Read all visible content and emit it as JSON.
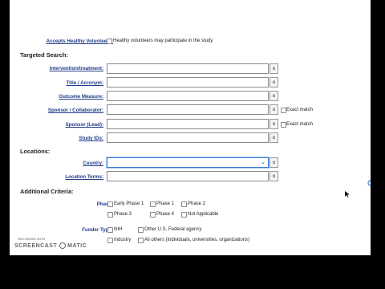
{
  "healthy_volunteers": {
    "label": "Accepts Healthy Volunteers:",
    "option": "Healthy volunteers may participate in the study"
  },
  "targeted_search": {
    "header": "Targeted Search:",
    "fields": [
      {
        "label": "Intervention/treatment:",
        "value": "",
        "clear": "x"
      },
      {
        "label": "Title / Acronym:",
        "value": "",
        "clear": "x"
      },
      {
        "label": "Outcome Measure:",
        "value": "",
        "clear": "x"
      },
      {
        "label": "Sponsor / Collaborator:",
        "value": "",
        "clear": "x",
        "exact_match": "Exact match"
      },
      {
        "label": "Sponsor (Lead):",
        "value": "",
        "clear": "x",
        "exact_match": "Exact match"
      },
      {
        "label": "Study IDs:",
        "value": "",
        "clear": "x"
      }
    ]
  },
  "locations": {
    "header": "Locations:",
    "country": {
      "label": "Country:",
      "value": "",
      "clear": "x"
    },
    "location_terms": {
      "label": "Location Terms:",
      "value": "",
      "clear": "x"
    }
  },
  "additional": {
    "header": "Additional Criteria:",
    "phase": {
      "label": "Phase:",
      "options": [
        "Early Phase 1",
        "Phase 1",
        "Phase 2",
        "Phase 3",
        "Phase 4",
        "Not Applicable"
      ]
    },
    "funder": {
      "label": "Funder Type:",
      "options": [
        "NIH",
        "Other U.S. Federal agency",
        "Industry",
        "All others (individuals, universities, organizations)"
      ]
    }
  },
  "watermark": {
    "line1": "RECORDED WITH",
    "line2": "SCREENCAST",
    "line3": "MATIC"
  }
}
